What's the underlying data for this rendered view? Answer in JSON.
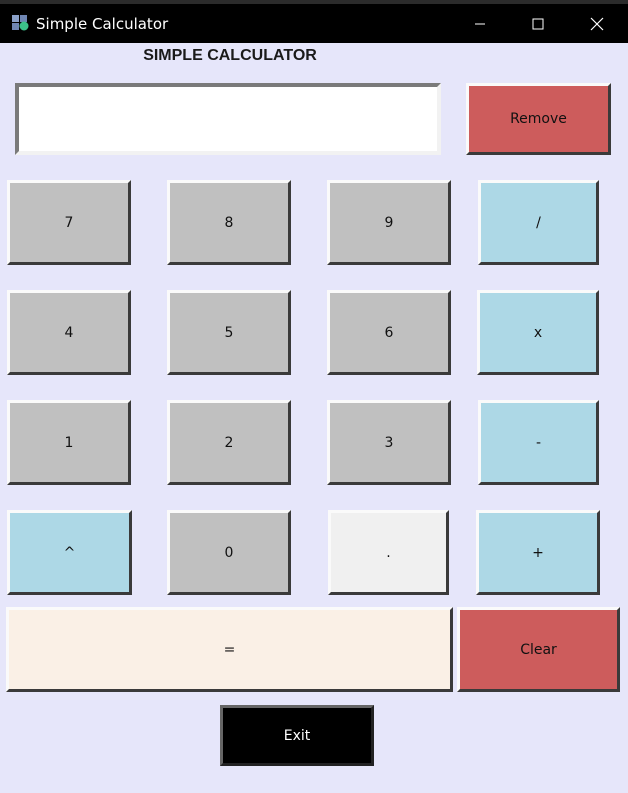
{
  "window": {
    "title": "Simple Calculator"
  },
  "heading": "SIMPLE CALCULATOR",
  "display": {
    "value": ""
  },
  "buttons": {
    "remove": "Remove",
    "seven": "7",
    "eight": "8",
    "nine": "9",
    "divide": "/",
    "four": "4",
    "five": "5",
    "six": "6",
    "multiply": "x",
    "one": "1",
    "two": "2",
    "three": "3",
    "minus": "-",
    "power": "^",
    "zero": "0",
    "dot": ".",
    "plus": "+",
    "equals": "=",
    "clear": "Clear",
    "exit": "Exit"
  },
  "colors": {
    "background": "#e6e6fa",
    "digit": "#c0c0c0",
    "operator": "#add8e6",
    "danger": "#cd5c5c",
    "equals": "#faf0e6",
    "dot": "#f0f0f0",
    "exit": "#000000"
  },
  "icons": {
    "app": "calculator-app-icon",
    "minimize": "minimize-icon",
    "maximize": "maximize-icon",
    "close": "close-icon"
  }
}
